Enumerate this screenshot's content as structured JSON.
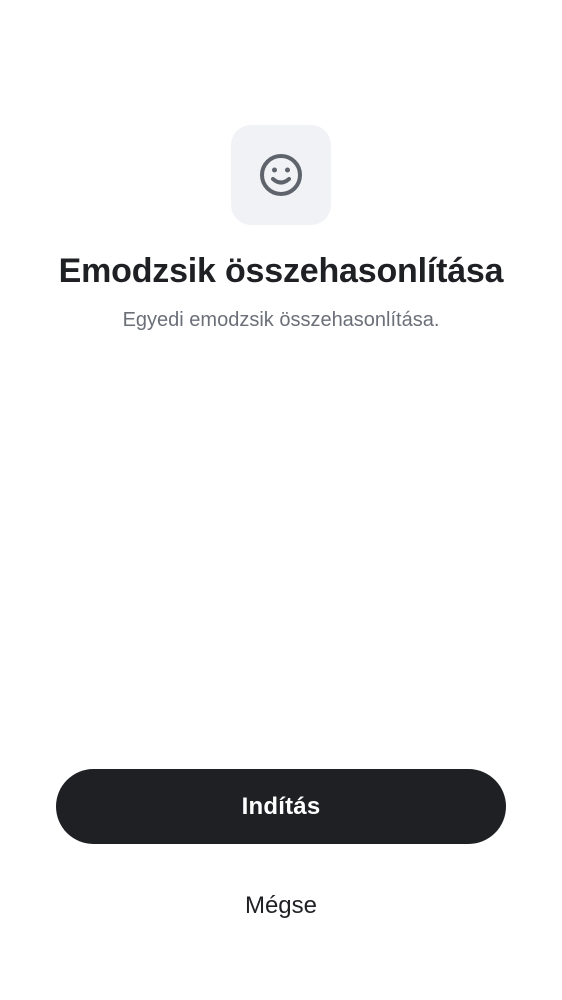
{
  "header": {
    "icon": "smiley-face-icon",
    "title": "Emodzsik összehasonlítása",
    "subtitle": "Egyedi emodzsik összehasonlítása."
  },
  "actions": {
    "primary_label": "Indítás",
    "secondary_label": "Mégse"
  },
  "colors": {
    "background": "#ffffff",
    "icon_tile": "#f1f2f5",
    "icon": "#5f636c",
    "primary_button": "#1f2024",
    "primary_text": "#ffffff",
    "title_text": "#1f2024",
    "subtitle_text": "#6b6f78"
  }
}
